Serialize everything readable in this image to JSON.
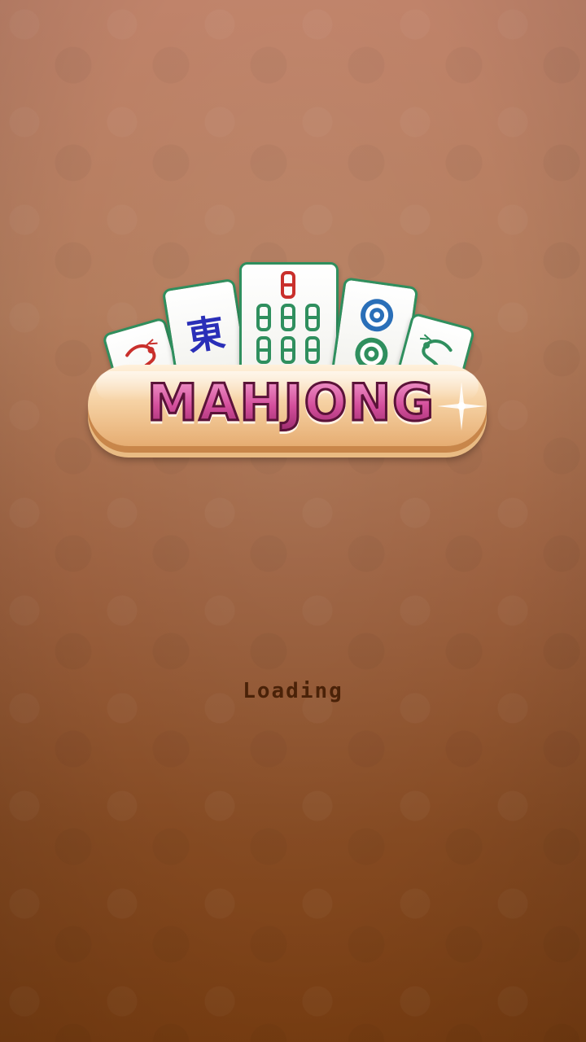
{
  "game": {
    "title": "MAHJONG",
    "tiles": [
      {
        "name": "red-dragon-tile",
        "icon": "red-dragon-icon"
      },
      {
        "name": "east-wind-tile",
        "icon": "east-wind-icon",
        "glyph": "東"
      },
      {
        "name": "bamboo-eight-tile",
        "icon": "bamboo-icon"
      },
      {
        "name": "circles-two-tile",
        "icon": "circle-dots-icon"
      },
      {
        "name": "green-dragon-tile",
        "icon": "green-dragon-icon"
      }
    ]
  },
  "status": {
    "loading_text": "Loading"
  },
  "colors": {
    "background_top": "#c0836a",
    "background_bottom": "#7a3e12",
    "tile_border": "#2f8f5e",
    "title_pink": "#d44f9c",
    "title_outline": "#5a1338",
    "loading_text": "#4a2208"
  }
}
